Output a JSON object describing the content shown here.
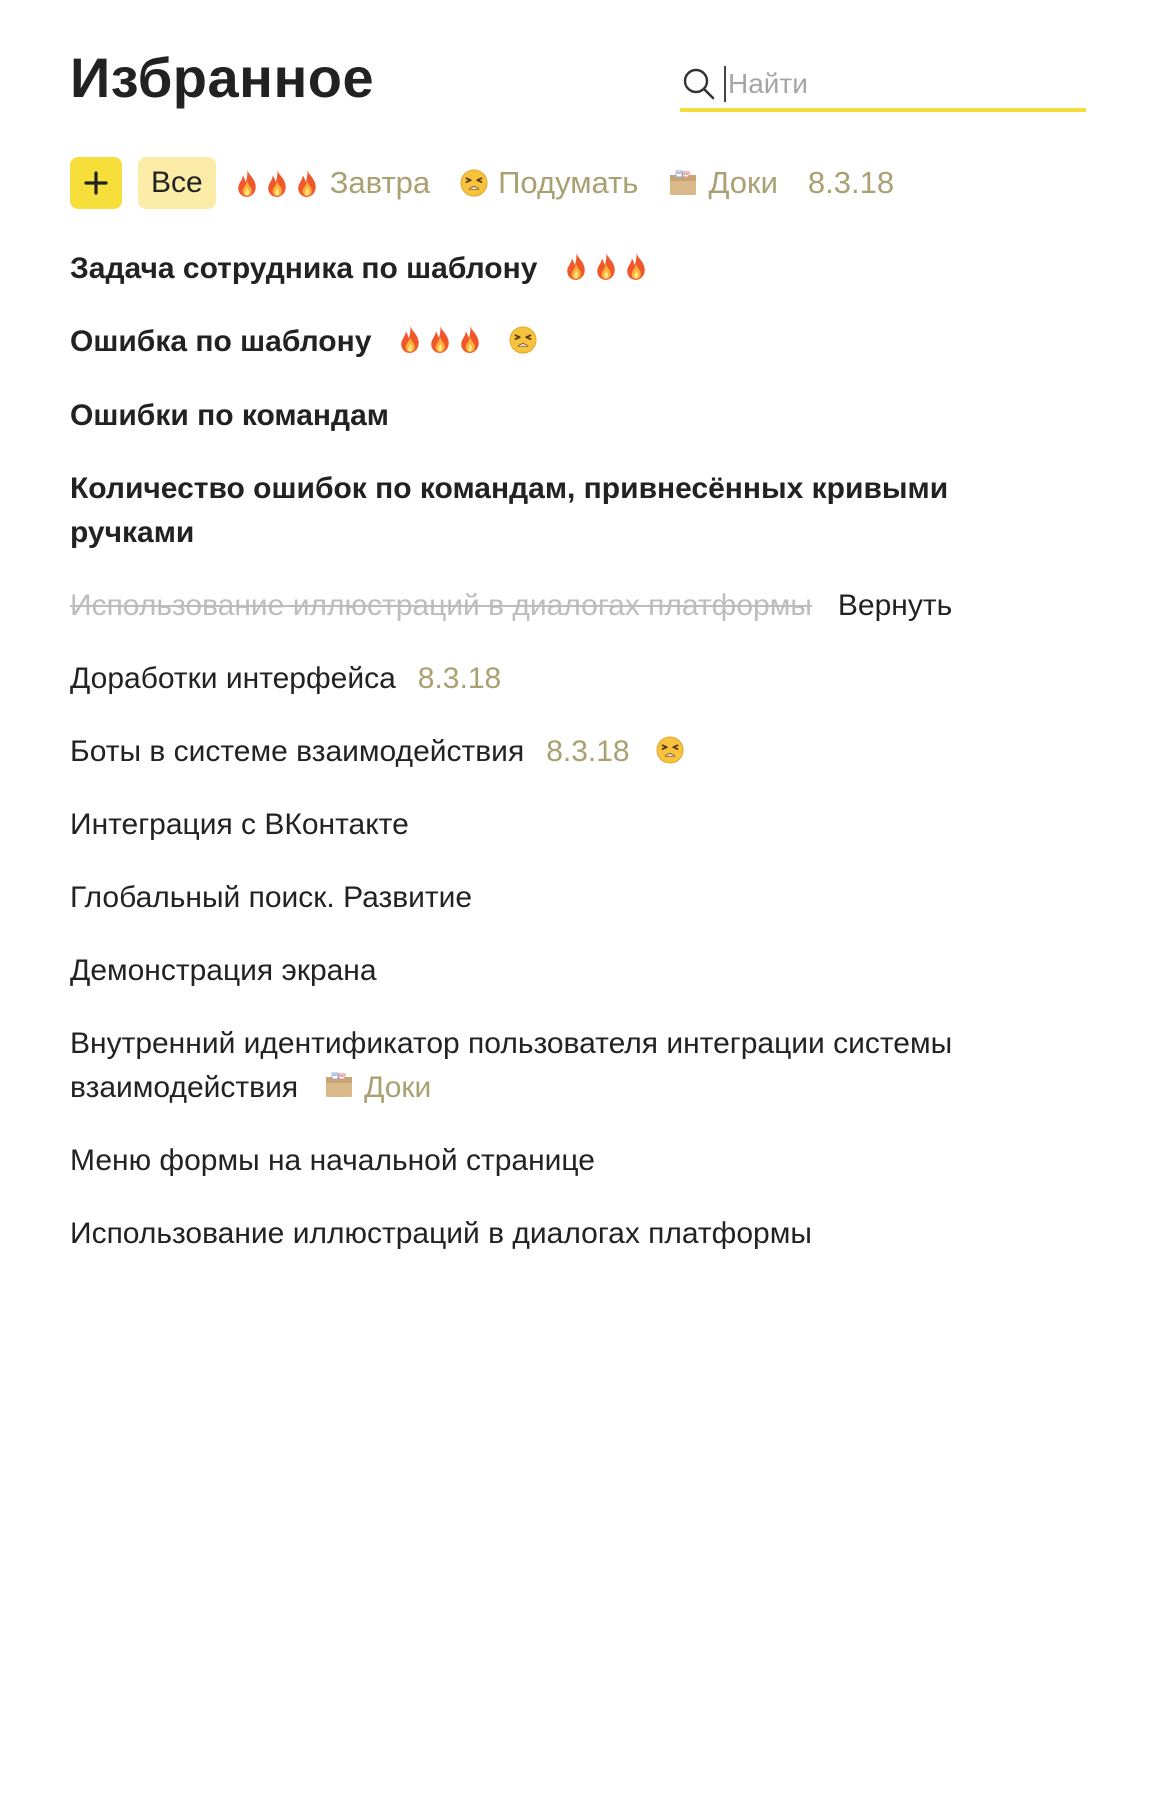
{
  "header": {
    "title": "Избранное"
  },
  "search": {
    "placeholder": "Найти",
    "value": ""
  },
  "filters": {
    "all_label": "Все",
    "tomorrow_label": "Завтра",
    "think_label": "Подумать",
    "docs_label": "Доки",
    "version_label": "8.3.18"
  },
  "tasks": [
    {
      "title": "Задача сотрудника по шаблону",
      "bold": true,
      "tags": [
        "fire",
        "fire",
        "fire"
      ]
    },
    {
      "title": "Ошибка по шаблону",
      "bold": true,
      "tags": [
        "fire",
        "fire",
        "fire",
        "tired-face"
      ]
    },
    {
      "title": "Ошибки по командам",
      "bold": true,
      "tags": []
    },
    {
      "title": "Количество ошибок по командам, привнесённых кривыми ручками",
      "bold": true,
      "tags": []
    },
    {
      "title": "Использование иллюстраций в диалогах платформы",
      "deleted": true,
      "action": "Вернуть"
    },
    {
      "title": "Доработки интерфейса",
      "tag_text": "8.3.18"
    },
    {
      "title": "Боты в системе взаимодействия",
      "tag_text": "8.3.18",
      "tags": [
        "tired-face"
      ]
    },
    {
      "title": "Интеграция с ВКонтакте"
    },
    {
      "title": "Глобальный поиск. Развитие"
    },
    {
      "title": "Демонстрация экрана"
    },
    {
      "title": "Внутренний идентификатор пользователя интеграции системы взаимодействия",
      "tags": [
        "box"
      ],
      "tag_text": "Доки"
    },
    {
      "title": "Меню формы на начальной странице"
    },
    {
      "title": "Использование иллюстраций в диалогах платформы"
    }
  ],
  "colors": {
    "accent_yellow": "#f7df3b",
    "selected_filter_bg": "#fbeda8",
    "tag_text": "#a9a171",
    "struck_text": "#bdbdbd"
  }
}
